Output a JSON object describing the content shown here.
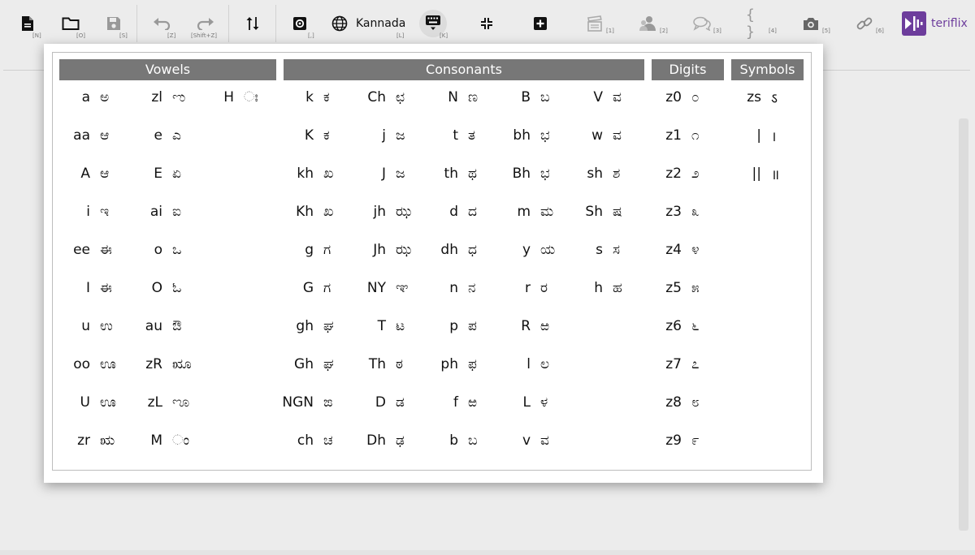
{
  "toolbar": {
    "keys": {
      "new": "[N]",
      "open": "[O]",
      "save": "[S]",
      "undo": "[Z]",
      "redo": "[Shift+Z]",
      "settings": "[,]",
      "language": "[L]",
      "keyboard": "[K]",
      "slot1": "[1]",
      "slot2": "[2]",
      "slot3": "[3]",
      "slot4": "[4]",
      "slot5": "[5]",
      "slot6": "[6]"
    },
    "language_label": "Kannada",
    "braces": "{ }",
    "brand_name": "teriflix"
  },
  "colors": {
    "header_bg": "#777777",
    "brand": "#6d3d9c"
  },
  "sections": {
    "vowels": "Vowels",
    "consonants": "Consonants",
    "digits": "Digits",
    "symbols": "Symbols"
  },
  "columns": [
    {
      "id": "v1",
      "items": [
        [
          "a",
          "ಅ"
        ],
        [
          "aa",
          "ಆ"
        ],
        [
          "A",
          "ಆ"
        ],
        [
          "i",
          "ಇ"
        ],
        [
          "ee",
          "ಈ"
        ],
        [
          "I",
          "ಈ"
        ],
        [
          "u",
          "ಉ"
        ],
        [
          "oo",
          "ಊ"
        ],
        [
          "U",
          "ಊ"
        ],
        [
          "zr",
          "ಋ"
        ]
      ]
    },
    {
      "id": "v2",
      "items": [
        [
          "zl",
          "ಌ"
        ],
        [
          "e",
          "ಎ"
        ],
        [
          "E",
          "ಏ"
        ],
        [
          "ai",
          "ಐ"
        ],
        [
          "o",
          "ಒ"
        ],
        [
          "O",
          "ಓ"
        ],
        [
          "au",
          "ಔ"
        ],
        [
          "zR",
          "ೠ"
        ],
        [
          "zL",
          "ೡ"
        ],
        [
          "M",
          "ಂ"
        ]
      ]
    },
    {
      "id": "v3",
      "items": [
        [
          "H",
          "ಃ"
        ]
      ]
    },
    {
      "id": "c1",
      "items": [
        [
          "k",
          "ಕ"
        ],
        [
          "K",
          "ಕ"
        ],
        [
          "kh",
          "ಖ"
        ],
        [
          "Kh",
          "ಖ"
        ],
        [
          "g",
          "ಗ"
        ],
        [
          "G",
          "ಗ"
        ],
        [
          "gh",
          "ಘ"
        ],
        [
          "Gh",
          "ಘ"
        ],
        [
          "NGN",
          "ಙ"
        ],
        [
          "ch",
          "ಚ"
        ]
      ]
    },
    {
      "id": "c2",
      "items": [
        [
          "Ch",
          "ಛ"
        ],
        [
          "j",
          "ಜ"
        ],
        [
          "J",
          "ಜ"
        ],
        [
          "jh",
          "ಝ"
        ],
        [
          "Jh",
          "ಝ"
        ],
        [
          "NY",
          "ಞ"
        ],
        [
          "T",
          "ಟ"
        ],
        [
          "Th",
          "ಠ"
        ],
        [
          "D",
          "ಡ"
        ],
        [
          "Dh",
          "ಢ"
        ]
      ]
    },
    {
      "id": "c3",
      "items": [
        [
          "N",
          "ಣ"
        ],
        [
          "t",
          "ತ"
        ],
        [
          "th",
          "ಥ"
        ],
        [
          "d",
          "ದ"
        ],
        [
          "dh",
          "ಧ"
        ],
        [
          "n",
          "ನ"
        ],
        [
          "p",
          "ಪ"
        ],
        [
          "ph",
          "ಫ"
        ],
        [
          "f",
          "ಱ"
        ],
        [
          "b",
          "ಬ"
        ]
      ]
    },
    {
      "id": "c4",
      "items": [
        [
          "B",
          "ಬ"
        ],
        [
          "bh",
          "ಭ"
        ],
        [
          "Bh",
          "ಭ"
        ],
        [
          "m",
          "ಮ"
        ],
        [
          "y",
          "ಯ"
        ],
        [
          "r",
          "ರ"
        ],
        [
          "R",
          "ಱ"
        ],
        [
          "l",
          "ಲ"
        ],
        [
          "L",
          "ಳ"
        ],
        [
          "v",
          "ವ"
        ]
      ]
    },
    {
      "id": "c5",
      "items": [
        [
          "V",
          "ವ"
        ],
        [
          "w",
          "ವ"
        ],
        [
          "sh",
          "ಶ"
        ],
        [
          "Sh",
          "ಷ"
        ],
        [
          "s",
          "ಸ"
        ],
        [
          "h",
          "ಹ"
        ]
      ]
    },
    {
      "id": "d1",
      "items": [
        [
          "z0",
          "೦"
        ],
        [
          "z1",
          "೧"
        ],
        [
          "z2",
          "೨"
        ],
        [
          "z3",
          "೩"
        ],
        [
          "z4",
          "೪"
        ],
        [
          "z5",
          "೫"
        ],
        [
          "z6",
          "೬"
        ],
        [
          "z7",
          "೭"
        ],
        [
          "z8",
          "೮"
        ],
        [
          "z9",
          "೯"
        ]
      ]
    },
    {
      "id": "s1",
      "items": [
        [
          "zs",
          "ऽ"
        ],
        [
          "|",
          "।"
        ],
        [
          "||",
          "॥"
        ]
      ]
    }
  ]
}
